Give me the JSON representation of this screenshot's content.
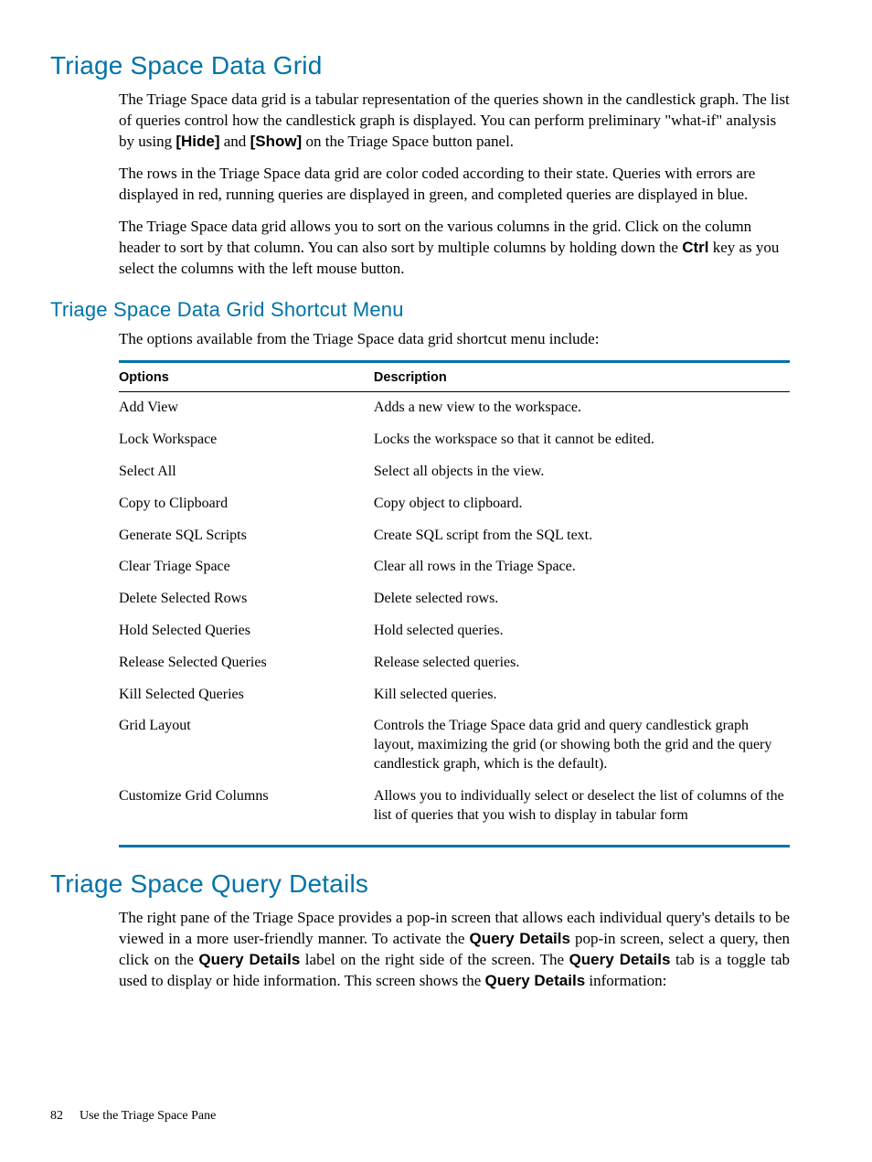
{
  "section1": {
    "title": "Triage Space Data Grid",
    "p1_a": "The Triage Space data grid is a tabular representation of the queries shown in the candlestick graph. The list of queries control how the candlestick graph is displayed. You can perform preliminary \"what-if\" analysis by using ",
    "p1_hide": "[Hide]",
    "p1_b": " and ",
    "p1_show": "[Show]",
    "p1_c": " on the Triage Space button panel.",
    "p2": "The rows in the Triage Space data grid are color coded according to their state. Queries with errors are displayed in red, running queries are displayed in green, and completed queries are displayed in blue.",
    "p3_a": "The Triage Space data grid allows you to sort on the various columns in the grid. Click on the column header to sort by that column. You can also sort by multiple columns by holding down the ",
    "p3_ctrl": "Ctrl",
    "p3_b": " key as you select the columns with the left mouse button."
  },
  "subsection": {
    "title": "Triage Space Data Grid Shortcut Menu",
    "intro": "The options available from the Triage Space data grid shortcut menu include:",
    "table": {
      "head_options": "Options",
      "head_description": "Description",
      "rows": [
        {
          "opt": "Add View",
          "desc": "Adds a new view to the workspace."
        },
        {
          "opt": "Lock Workspace",
          "desc": "Locks the workspace so that it cannot be edited."
        },
        {
          "opt": "Select All",
          "desc": "Select all objects in the view."
        },
        {
          "opt": "Copy to Clipboard",
          "desc": "Copy object to clipboard."
        },
        {
          "opt": "Generate SQL Scripts",
          "desc": "Create SQL script from the SQL text."
        },
        {
          "opt": "Clear Triage Space",
          "desc": "Clear all rows in the Triage Space."
        },
        {
          "opt": "Delete Selected Rows",
          "desc": "Delete selected rows."
        },
        {
          "opt": "Hold Selected Queries",
          "desc": "Hold selected queries."
        },
        {
          "opt": "Release Selected Queries",
          "desc": "Release selected queries."
        },
        {
          "opt": "Kill Selected Queries",
          "desc": "Kill selected queries."
        },
        {
          "opt": "Grid Layout",
          "desc": "Controls the Triage Space data grid and query candlestick graph layout, maximizing the grid (or showing both the grid and the query candlestick graph, which is the default)."
        },
        {
          "opt": "Customize Grid Columns",
          "desc": "Allows you to individually select or deselect the list of columns of the list of queries that you wish to display in tabular form"
        }
      ]
    }
  },
  "section2": {
    "title": "Triage Space Query Details",
    "p1_a": "The right pane of the Triage Space provides a  pop-in screen that allows each individual query's details to be viewed in a more user-friendly manner. To activate the ",
    "p1_qd1": "Query Details",
    "p1_b": " pop-in screen, select a query, then click on the ",
    "p1_qd2": "Query Details",
    "p1_c": " label on the right side of the screen. The ",
    "p1_qd3": "Query Details",
    "p1_d": " tab is a toggle tab used to display or hide information. This screen shows the ",
    "p1_qd4": "Query Details",
    "p1_e": " information:"
  },
  "footer": {
    "page_number": "82",
    "chapter": "Use the Triage Space Pane"
  }
}
